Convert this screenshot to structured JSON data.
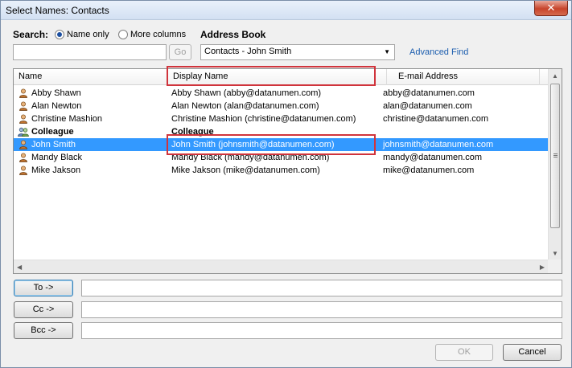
{
  "window": {
    "title": "Select Names: Contacts",
    "close_glyph": "✕"
  },
  "search": {
    "label": "Search:",
    "options": [
      "Name only",
      "More columns"
    ],
    "selected": "Name only",
    "value": "",
    "go_label": "Go"
  },
  "address_book": {
    "label": "Address Book",
    "selected": "Contacts - John Smith",
    "advanced_find": "Advanced Find"
  },
  "list": {
    "columns": [
      "Name",
      "Display Name",
      "E-mail Address"
    ],
    "rows": [
      {
        "name": "Abby Shawn",
        "display": "Abby Shawn (abby@datanumen.com)",
        "email": "abby@datanumen.com",
        "icon": "person-icon"
      },
      {
        "name": "Alan Newton",
        "display": "Alan Newton (alan@datanumen.com)",
        "email": "alan@datanumen.com",
        "icon": "person-icon"
      },
      {
        "name": "Christine Mashion",
        "display": "Christine Mashion (christine@datanumen.com)",
        "email": "christine@datanumen.com",
        "icon": "person-icon"
      },
      {
        "name": "Colleague",
        "display": "Colleague",
        "email": "",
        "icon": "group-icon"
      },
      {
        "name": "John Smith",
        "display": "John Smith (johnsmith@datanumen.com)",
        "email": "johnsmith@datanumen.com",
        "icon": "person-icon"
      },
      {
        "name": "Mandy Black",
        "display": "Mandy Black (mandy@datanumen.com)",
        "email": "mandy@datanumen.com",
        "icon": "person-icon"
      },
      {
        "name": "Mike Jakson",
        "display": "Mike Jakson (mike@datanumen.com)",
        "email": "mike@datanumen.com",
        "icon": "person-icon"
      }
    ],
    "selected_row": "John Smith"
  },
  "recipients": {
    "to_label": "To ->",
    "cc_label": "Cc ->",
    "bcc_label": "Bcc ->",
    "to_value": "",
    "cc_value": "",
    "bcc_value": ""
  },
  "footer": {
    "ok_label": "OK",
    "cancel_label": "Cancel"
  },
  "colors": {
    "selection": "#3399ff",
    "highlight_box": "#d0343c",
    "link": "#1b5dae"
  }
}
